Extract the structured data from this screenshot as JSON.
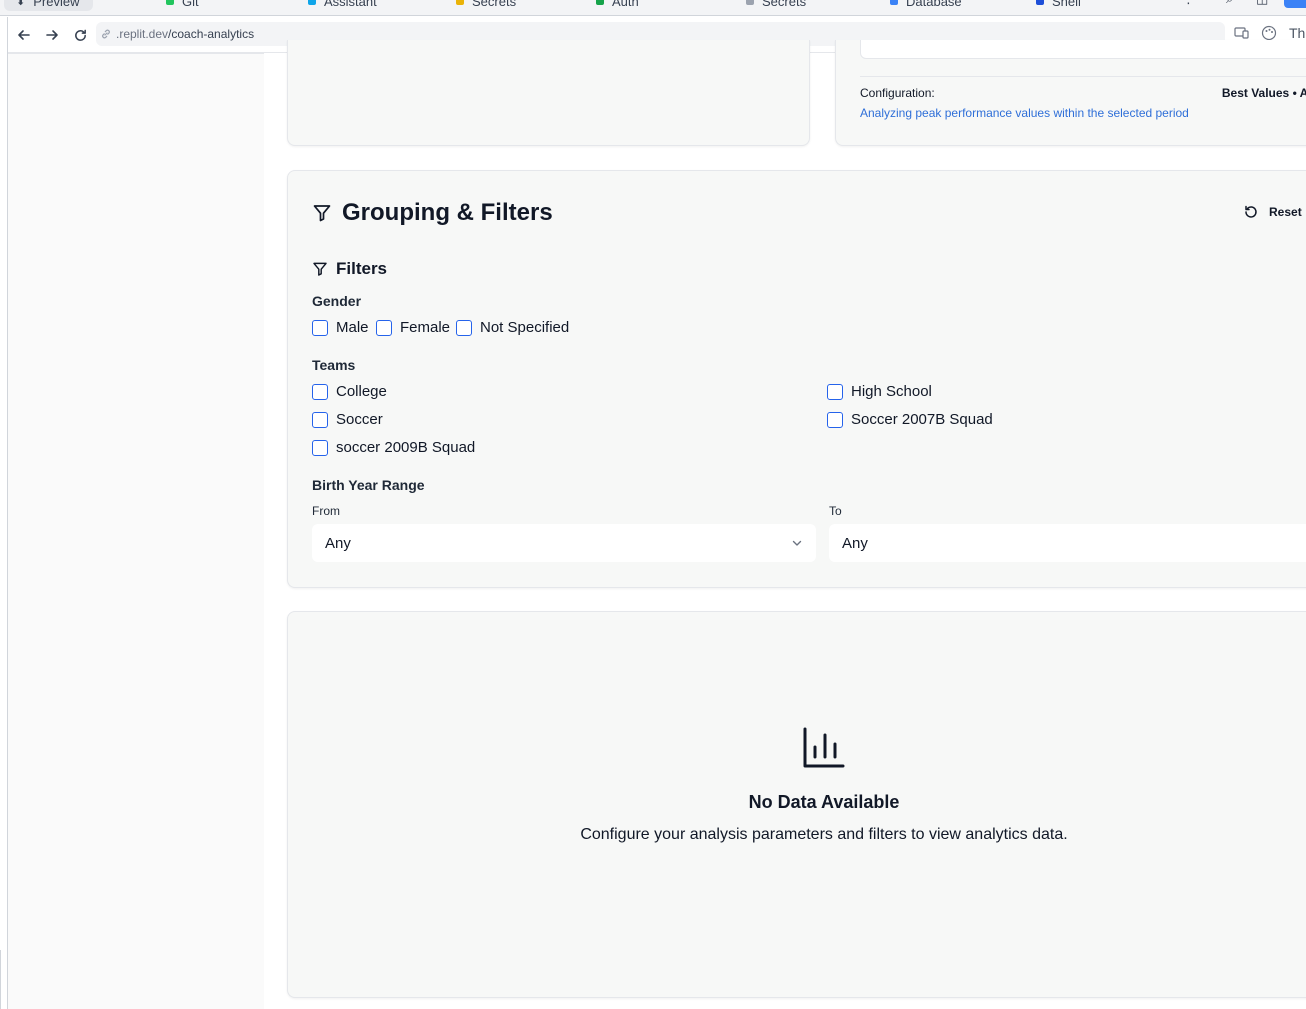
{
  "browser": {
    "tabs": [
      {
        "label": "Preview"
      },
      {
        "label": "Git"
      },
      {
        "label": "Assistant"
      },
      {
        "label": "Secrets"
      },
      {
        "label": "Auth"
      },
      {
        "label": "Secrets"
      },
      {
        "label": "Database"
      },
      {
        "label": "Shell"
      }
    ],
    "url_prefix": ".replit.dev",
    "url_path": "/coach-analytics",
    "right_label": "The"
  },
  "config": {
    "label": "Configuration:",
    "value": "Best Values • All",
    "description": "Analyzing peak performance values within the selected period"
  },
  "filters_card": {
    "title": "Grouping & Filters",
    "reset_label": "Reset",
    "filters_heading": "Filters",
    "gender": {
      "label": "Gender",
      "options": [
        "Male",
        "Female",
        "Not Specified"
      ]
    },
    "teams": {
      "label": "Teams",
      "options": [
        "College",
        "High School",
        "Soccer",
        "Soccer 2007B Squad",
        "soccer 2009B Squad"
      ]
    },
    "birth_year": {
      "label": "Birth Year Range",
      "from_label": "From",
      "from_value": "Any",
      "to_label": "To",
      "to_value": "Any"
    }
  },
  "empty_state": {
    "title": "No Data Available",
    "description": "Configure your analysis parameters and filters to view analytics data."
  },
  "colors": {
    "accent": "#2563eb",
    "link": "#2f6fd8",
    "card_bg": "#f7f8f7"
  }
}
